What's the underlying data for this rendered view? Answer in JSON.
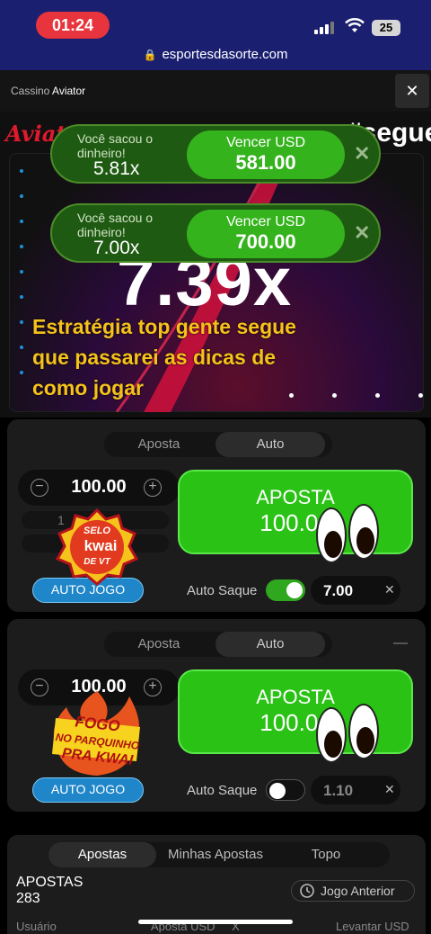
{
  "status_bar": {
    "time": "01:24",
    "battery": "25",
    "url": "esportesdasorte.com"
  },
  "game_header": {
    "section": "Cassino",
    "game": "Aviator"
  },
  "game": {
    "logo": "Aviat",
    "multiplier": "7.39x",
    "overlay_text": "Estratégia top gente segue que passarei as dicas de como jogar",
    "hashtag": "#segue"
  },
  "toasts": [
    {
      "label": "Você sacou o dinheiro!",
      "multiplier": "5.81x",
      "win_label": "Vencer USD",
      "win_value": "581.00"
    },
    {
      "label": "Você sacou o dinheiro!",
      "multiplier": "7.00x",
      "win_label": "Vencer USD",
      "win_value": "700.00"
    }
  ],
  "panels": [
    {
      "tabs": [
        "Aposta",
        "Auto"
      ],
      "active_tab": "Auto",
      "amount": "100.00",
      "quick_partial": "1",
      "bet_label": "APOSTA",
      "bet_value": "100.00",
      "auto_jogo": "AUTO JOGO",
      "auto_saque_label": "Auto Saque",
      "auto_saque_on": true,
      "cashout": "7.00"
    },
    {
      "tabs": [
        "Aposta",
        "Auto"
      ],
      "active_tab": "Auto",
      "amount": "100.00",
      "bet_label": "APOSTA",
      "bet_value": "100.00",
      "auto_jogo": "AUTO JOGO",
      "auto_saque_label": "Auto Saque",
      "auto_saque_on": false,
      "cashout": "1.10"
    }
  ],
  "stickers": {
    "selo": [
      "SELO",
      "kwai",
      "DE VT"
    ],
    "fogo": [
      "FOGO",
      "NO PARQUINHO",
      "PRA KWAI"
    ]
  },
  "bets_section": {
    "tabs": [
      "Apostas",
      "Minhas Apostas",
      "Topo"
    ],
    "active_tab": "Apostas",
    "title": "APOSTAS",
    "count": "283",
    "previous_round": "Jogo Anterior",
    "columns": [
      "Usuário",
      "Aposta USD",
      "X",
      "Levantar USD"
    ]
  },
  "colors": {
    "bet_green": "#29c215",
    "auto_jogo_blue": "#1e86c9",
    "aviator_red": "#e01a2c",
    "overlay_yellow": "#f5c21b"
  }
}
